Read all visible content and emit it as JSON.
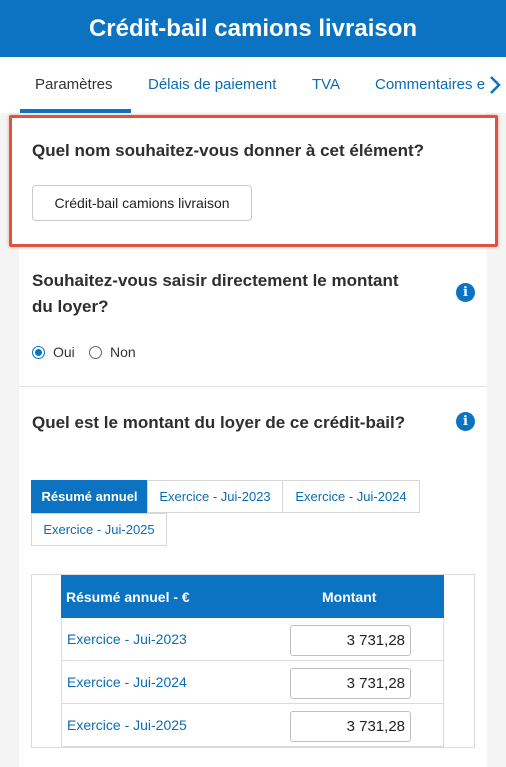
{
  "header": {
    "title": "Crédit-bail camions livraison"
  },
  "tabs": [
    {
      "label": "Paramètres",
      "active": true
    },
    {
      "label": "Délais de paiement",
      "active": false
    },
    {
      "label": "TVA",
      "active": false
    },
    {
      "label": "Commentaires e",
      "active": false
    }
  ],
  "icons": {
    "tab_next": "chevron-right-icon",
    "info": "info-icon"
  },
  "name_question": {
    "label": "Quel nom souhaitez-vous donner à cet élément?",
    "value": "Crédit-bail camions livraison"
  },
  "rent_direct_question": {
    "label_line1": "Souhaitez-vous saisir directement le montant",
    "label_line2": "du loyer?",
    "options": [
      {
        "label": "Oui",
        "selected": true
      },
      {
        "label": "Non",
        "selected": false
      }
    ]
  },
  "rent_amount_question": {
    "label": "Quel est le montant du loyer de ce crédit-bail?"
  },
  "period_tabs": [
    {
      "label": "Résumé annuel",
      "active": true
    },
    {
      "label": "Exercice - Jui-2023",
      "active": false
    },
    {
      "label": "Exercice - Jui-2024",
      "active": false
    },
    {
      "label": "Exercice - Jui-2025",
      "active": false
    }
  ],
  "table": {
    "columns": [
      "Résumé annuel - €",
      "Montant"
    ],
    "rows": [
      {
        "label": "Exercice - Jui-2023",
        "value": "3 731,28"
      },
      {
        "label": "Exercice - Jui-2024",
        "value": "3 731,28"
      },
      {
        "label": "Exercice - Jui-2025",
        "value": "3 731,28"
      }
    ]
  },
  "colors": {
    "primary": "#0b73c2",
    "highlight_border": "#e0533f",
    "link": "#0b6cb3"
  }
}
